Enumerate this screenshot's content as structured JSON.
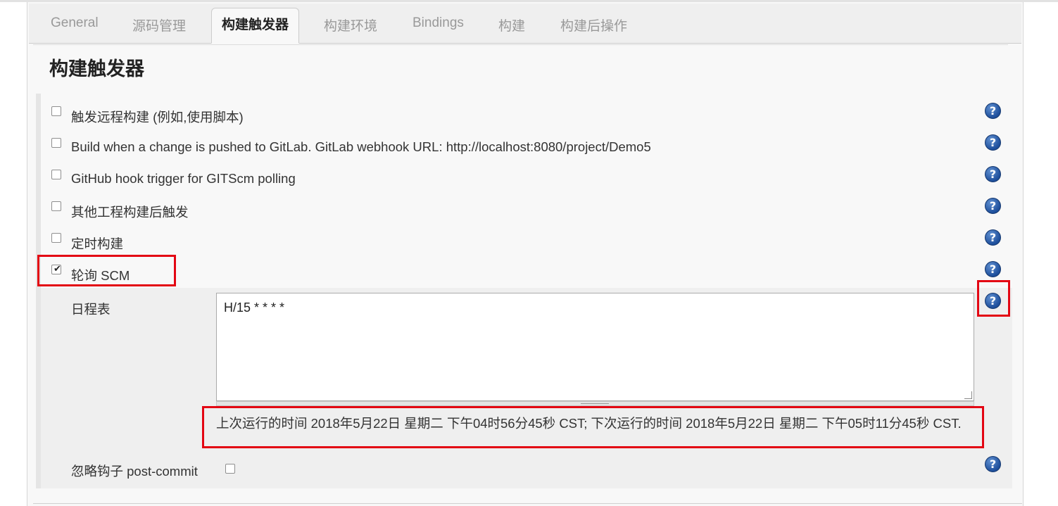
{
  "tabs": [
    "General",
    "源码管理",
    "构建触发器",
    "构建环境",
    "Bindings",
    "构建",
    "构建后操作"
  ],
  "active_tab": "构建触发器",
  "section_title": "构建触发器",
  "triggers": [
    {
      "label": "触发远程构建 (例如,使用脚本)",
      "checked": false
    },
    {
      "label": "Build when a change is pushed to GitLab. GitLab webhook URL: http://localhost:8080/project/Demo5",
      "checked": false
    },
    {
      "label": "GitHub hook trigger for GITScm polling",
      "checked": false
    },
    {
      "label": "其他工程构建后触发",
      "checked": false
    },
    {
      "label": "定时构建",
      "checked": false
    },
    {
      "label": "轮询 SCM",
      "checked": true
    }
  ],
  "schedule": {
    "label": "日程表",
    "value": "H/15 * * * *",
    "status": "上次运行的时间 2018年5月22日 星期二 下午04时56分45秒 CST; 下次运行的时间 2018年5月22日 星期二 下午05时11分45秒 CST."
  },
  "ignore_post_commit": {
    "label": "忽略钩子 post-commit",
    "checked": false
  },
  "help_glyph": "?",
  "colors": {
    "highlight": "#e30613",
    "help_icon": "#2a5ea8"
  }
}
